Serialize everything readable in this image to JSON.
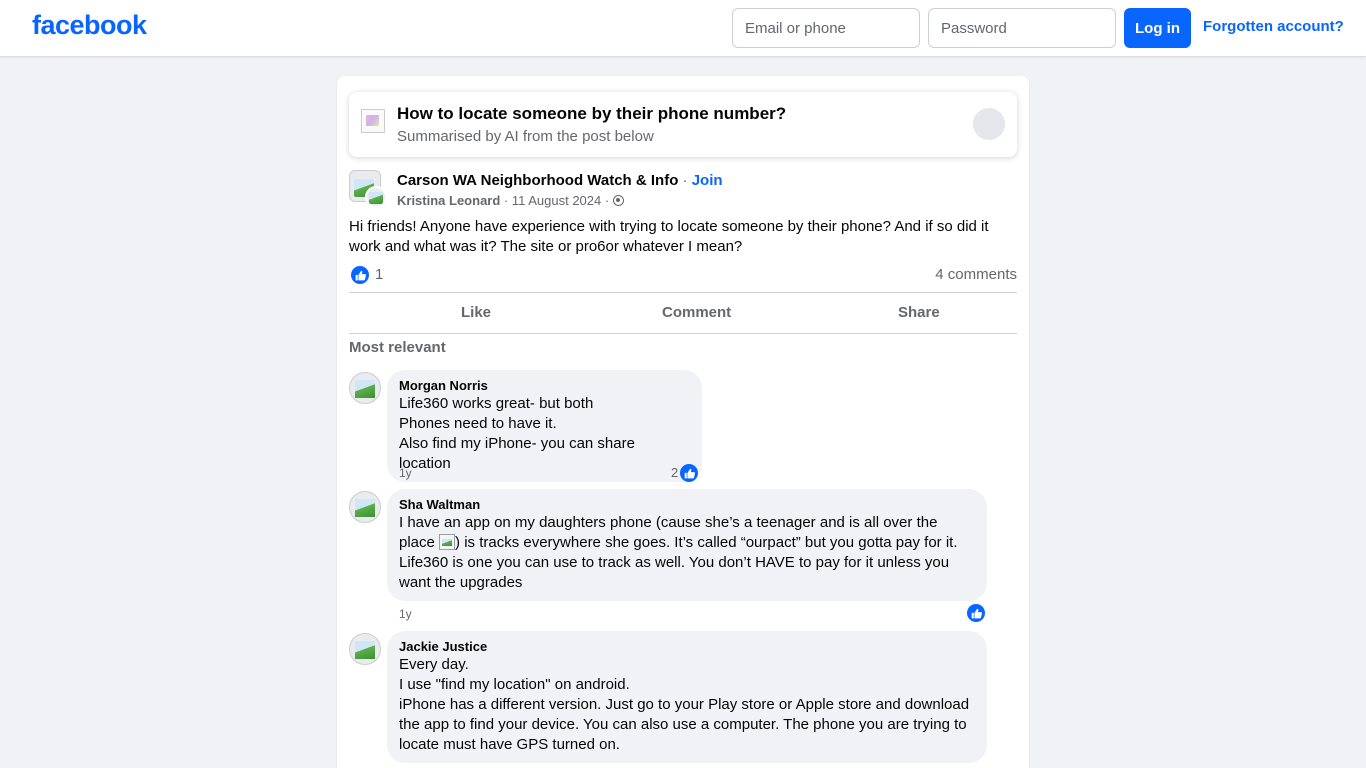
{
  "header": {
    "logo": "facebook",
    "email_placeholder": "Email or phone",
    "password_placeholder": "Password",
    "login_label": "Log in",
    "forgot_label": "Forgotten account?"
  },
  "summary": {
    "title": "How to locate someone by their phone number?",
    "subtitle": "Summarised by AI from the post below"
  },
  "post": {
    "group": "Carson WA Neighborhood Watch & Info",
    "join_sep": " · ",
    "join_label": "Join",
    "author": "Kristina Leonard",
    "date": " · 11 August 2024 · ",
    "text": "Hi friends! Anyone have experience with trying to locate someone by their phone? And if so did it work and what was it? The site or pro6or whatever I mean?",
    "reaction_count": "1",
    "comments_count": "4 comments",
    "actions": {
      "like": "Like",
      "comment": "Comment",
      "share": "Share"
    },
    "sort_label": "Most relevant"
  },
  "comments": [
    {
      "name": "Morgan Norris",
      "text": "Life360 works great- but both\nPhones need to have it.\nAlso find my iPhone- you can share location",
      "time": "1y",
      "reactions": "2"
    },
    {
      "name": "Sha Waltman",
      "text_before": "I have an app on my daughters phone (cause she’s a teenager and is all over the place ",
      "text_after": ") is tracks everywhere she goes. It’s called “ourpact” but you gotta pay for it. Life360 is one you can use to track as well. You don’t HAVE to pay for it unless you want the upgrades",
      "time": "1y",
      "reactions": ""
    },
    {
      "name": "Jackie Justice",
      "text": "Every day.\nI use \"find my location\" on android.\niPhone has a different version. Just go to your Play store or Apple store and download the app to find your device. You can also use a computer. The phone you are trying to locate must have GPS turned on.",
      "time": "",
      "reactions": ""
    }
  ],
  "colors": {
    "brand": "#0866ff",
    "muted": "#65676b",
    "bubble": "#f0f2f5"
  }
}
